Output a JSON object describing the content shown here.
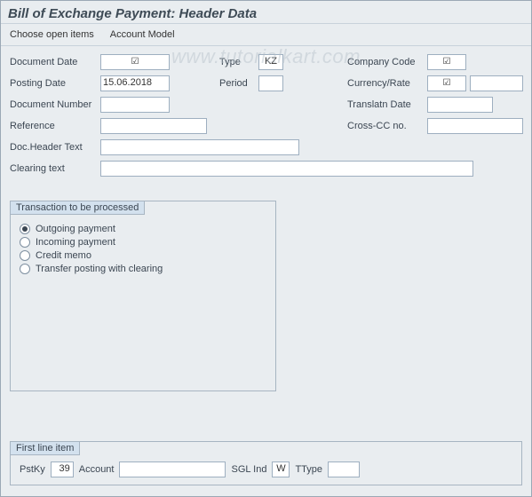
{
  "title": "Bill of Exchange Payment: Header Data",
  "toolbar": {
    "choose_open_items": "Choose open items",
    "account_model": "Account Model"
  },
  "watermark": "www.tutorialkart.com",
  "header": {
    "document_date": {
      "label": "Document Date",
      "value": "☑"
    },
    "posting_date": {
      "label": "Posting Date",
      "value": "15.06.2018"
    },
    "document_number": {
      "label": "Document Number",
      "value": ""
    },
    "reference": {
      "label": "Reference",
      "value": ""
    },
    "doc_header_text": {
      "label": "Doc.Header Text",
      "value": ""
    },
    "clearing_text": {
      "label": "Clearing text",
      "value": ""
    },
    "type": {
      "label": "Type",
      "value": "KZ"
    },
    "period": {
      "label": "Period",
      "value": ""
    },
    "company_code": {
      "label": "Company Code",
      "value": "☑"
    },
    "currency_rate": {
      "label": "Currency/Rate",
      "value1": "☑",
      "value2": ""
    },
    "translatn_date": {
      "label": "Translatn Date",
      "value": ""
    },
    "cross_cc_no": {
      "label": "Cross-CC no.",
      "value": ""
    }
  },
  "transaction_group": {
    "title": "Transaction to be processed",
    "options": {
      "outgoing": "Outgoing payment",
      "incoming": "Incoming payment",
      "credit_memo": "Credit memo",
      "transfer": "Transfer posting with clearing"
    },
    "selected": "outgoing"
  },
  "first_line": {
    "title": "First line item",
    "pstky": {
      "label": "PstKy",
      "value": "39"
    },
    "account": {
      "label": "Account",
      "value": ""
    },
    "sgl_ind": {
      "label": "SGL Ind",
      "value": "W"
    },
    "ttype": {
      "label": "TType",
      "value": ""
    }
  }
}
